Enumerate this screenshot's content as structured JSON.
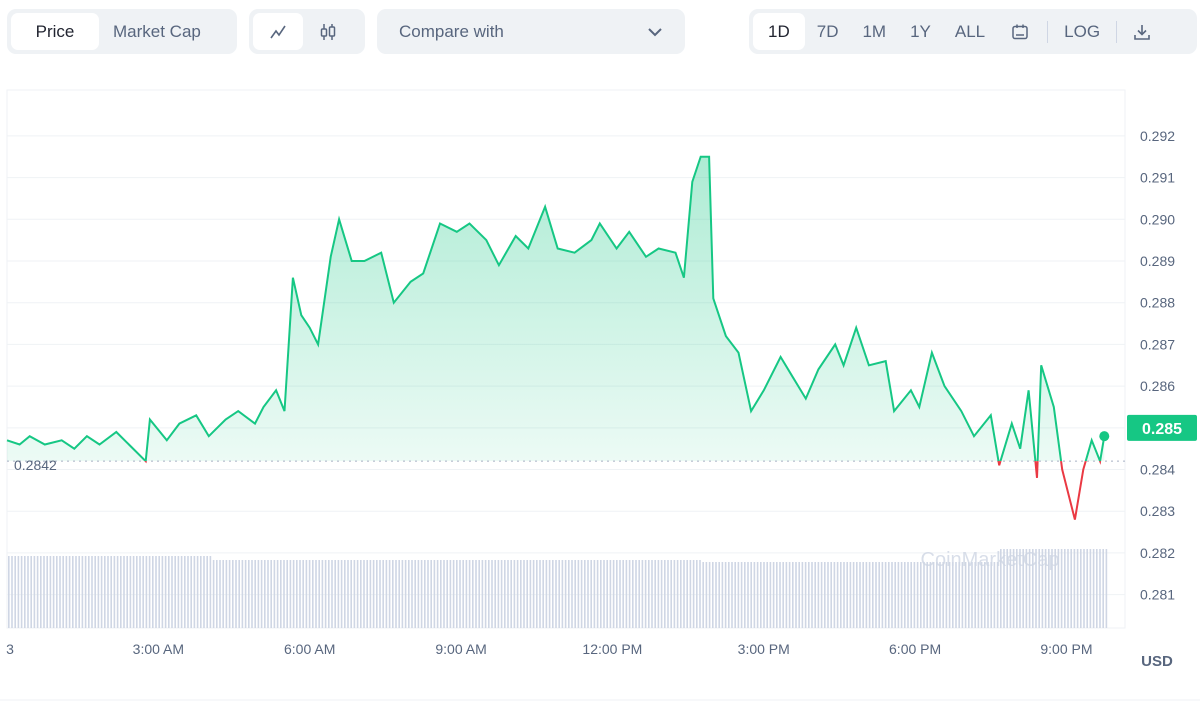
{
  "toolbar": {
    "metric_tabs": [
      {
        "label": "Price",
        "active": true
      },
      {
        "label": "Market Cap",
        "active": false
      }
    ],
    "chart_type_icons": [
      "line-chart-icon",
      "candlestick-icon"
    ],
    "compare_label": "Compare with",
    "ranges": [
      {
        "label": "1D",
        "active": true
      },
      {
        "label": "7D"
      },
      {
        "label": "1M"
      },
      {
        "label": "1Y"
      },
      {
        "label": "ALL"
      }
    ],
    "log_label": "LOG"
  },
  "colors": {
    "up": "#16c784",
    "down": "#ea3943",
    "volume": "#cfd6e4",
    "grid": "#eff2f5"
  },
  "chart_data": {
    "type": "area",
    "x_tick_labels": [
      "3",
      "3:00 AM",
      "6:00 AM",
      "9:00 AM",
      "12:00 PM",
      "3:00 PM",
      "6:00 PM",
      "9:00 PM"
    ],
    "x_tick_times": [
      "00:00",
      "03:00",
      "06:00",
      "09:00",
      "12:00",
      "15:00",
      "18:00",
      "21:00"
    ],
    "y_tick_labels": [
      "0.281",
      "0.282",
      "0.283",
      "0.284",
      "0.285",
      "0.286",
      "0.287",
      "0.288",
      "0.289",
      "0.290",
      "0.291",
      "0.292"
    ],
    "ylim": [
      0.2802,
      0.2931
    ],
    "baseline": 0.2842,
    "baseline_label": "0.2842",
    "current_price_label": "0.285",
    "currency_label": "USD",
    "watermark": "CoinMarketCap",
    "grid": true,
    "points": [
      [
        "00:00",
        0.2847
      ],
      [
        "00:15",
        0.2846
      ],
      [
        "00:27",
        0.2848
      ],
      [
        "00:45",
        0.2846
      ],
      [
        "01:05",
        0.2847
      ],
      [
        "01:20",
        0.2845
      ],
      [
        "01:35",
        0.2848
      ],
      [
        "01:50",
        0.2846
      ],
      [
        "02:10",
        0.2849
      ],
      [
        "02:25",
        0.2846
      ],
      [
        "02:45",
        0.2842
      ],
      [
        "02:50",
        0.2852
      ],
      [
        "03:10",
        0.2847
      ],
      [
        "03:25",
        0.2851
      ],
      [
        "03:45",
        0.2853
      ],
      [
        "04:00",
        0.2848
      ],
      [
        "04:20",
        0.2852
      ],
      [
        "04:35",
        0.2854
      ],
      [
        "04:55",
        0.2851
      ],
      [
        "05:05",
        0.2855
      ],
      [
        "05:20",
        0.2859
      ],
      [
        "05:30",
        0.2854
      ],
      [
        "05:40",
        0.2886
      ],
      [
        "05:50",
        0.2877
      ],
      [
        "06:00",
        0.2874
      ],
      [
        "06:10",
        0.287
      ],
      [
        "06:25",
        0.2891
      ],
      [
        "06:35",
        0.29
      ],
      [
        "06:50",
        0.289
      ],
      [
        "07:05",
        0.289
      ],
      [
        "07:25",
        0.2892
      ],
      [
        "07:40",
        0.288
      ],
      [
        "08:00",
        0.2885
      ],
      [
        "08:15",
        0.2887
      ],
      [
        "08:35",
        0.2899
      ],
      [
        "08:55",
        0.2897
      ],
      [
        "09:10",
        0.2899
      ],
      [
        "09:30",
        0.2895
      ],
      [
        "09:45",
        0.2889
      ],
      [
        "10:05",
        0.2896
      ],
      [
        "10:20",
        0.2893
      ],
      [
        "10:40",
        0.2903
      ],
      [
        "10:55",
        0.2893
      ],
      [
        "11:15",
        0.2892
      ],
      [
        "11:35",
        0.2895
      ],
      [
        "11:45",
        0.2899
      ],
      [
        "12:05",
        0.2893
      ],
      [
        "12:20",
        0.2897
      ],
      [
        "12:40",
        0.2891
      ],
      [
        "12:55",
        0.2893
      ],
      [
        "13:15",
        0.2892
      ],
      [
        "13:25",
        0.2886
      ],
      [
        "13:35",
        0.2909
      ],
      [
        "13:45",
        0.2915
      ],
      [
        "13:55",
        0.2915
      ],
      [
        "14:00",
        0.2881
      ],
      [
        "14:15",
        0.2872
      ],
      [
        "14:30",
        0.2868
      ],
      [
        "14:45",
        0.2854
      ],
      [
        "15:00",
        0.2859
      ],
      [
        "15:20",
        0.2867
      ],
      [
        "15:35",
        0.2862
      ],
      [
        "15:50",
        0.2857
      ],
      [
        "16:05",
        0.2864
      ],
      [
        "16:25",
        0.287
      ],
      [
        "16:35",
        0.2865
      ],
      [
        "16:50",
        0.2874
      ],
      [
        "17:05",
        0.2865
      ],
      [
        "17:25",
        0.2866
      ],
      [
        "17:35",
        0.2854
      ],
      [
        "17:55",
        0.2859
      ],
      [
        "18:05",
        0.2855
      ],
      [
        "18:20",
        0.2868
      ],
      [
        "18:35",
        0.286
      ],
      [
        "18:55",
        0.2854
      ],
      [
        "19:10",
        0.2848
      ],
      [
        "19:30",
        0.2853
      ],
      [
        "19:40",
        0.2841
      ],
      [
        "19:55",
        0.2851
      ],
      [
        "20:05",
        0.2845
      ],
      [
        "20:15",
        0.2859
      ],
      [
        "20:25",
        0.2838
      ],
      [
        "20:30",
        0.2865
      ],
      [
        "20:45",
        0.2855
      ],
      [
        "20:55",
        0.284
      ],
      [
        "21:10",
        0.2828
      ],
      [
        "21:20",
        0.284
      ],
      [
        "21:30",
        0.2847
      ],
      [
        "21:40",
        0.2842
      ],
      [
        "21:45",
        0.2848
      ]
    ]
  }
}
